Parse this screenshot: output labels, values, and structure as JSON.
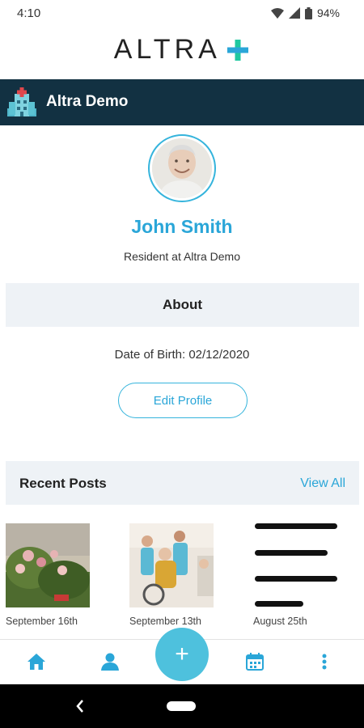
{
  "status_bar": {
    "time": "4:10",
    "battery": "94%"
  },
  "app": {
    "logo_text": "ALTRA",
    "accent_color": "#1ec8a0"
  },
  "title_bar": {
    "title": "Altra Demo",
    "background": "#123142"
  },
  "profile": {
    "name": "John Smith",
    "subtitle": "Resident at Altra Demo",
    "about_heading": "About",
    "date_of_birth": "Date of Birth: 02/12/2020",
    "edit_button": "Edit Profile"
  },
  "recent_posts": {
    "heading": "Recent Posts",
    "view_all": "View All",
    "items": [
      {
        "date": "September 16th",
        "type": "image"
      },
      {
        "date": "September 13th",
        "type": "image"
      },
      {
        "date": "August 25th",
        "type": "text"
      }
    ]
  },
  "bottom_nav": {
    "items": [
      "home-icon",
      "profile-icon",
      "add-icon",
      "calendar-icon",
      "more-icon"
    ],
    "fab_label": "+"
  },
  "colors": {
    "accent": "#2aa6d8",
    "header_bg": "#123142",
    "section_bg": "#eef2f6"
  }
}
